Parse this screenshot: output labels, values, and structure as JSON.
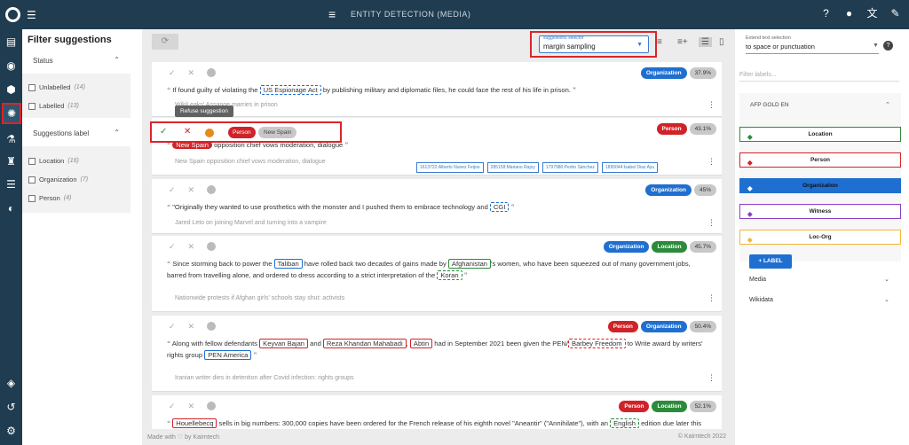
{
  "topbar": {
    "title": "ENTITY DETECTION (MEDIA)"
  },
  "filters": {
    "title": "Filter suggestions",
    "status": {
      "label": "Status",
      "items": [
        {
          "label": "Unlabelled",
          "count": "(14)"
        },
        {
          "label": "Labelled",
          "count": "(13)"
        }
      ]
    },
    "suggestions_label": {
      "label": "Suggestions label",
      "items": [
        {
          "label": "Location",
          "count": "(16)"
        },
        {
          "label": "Organization",
          "count": "(7)"
        },
        {
          "label": "Person",
          "count": "(4)"
        }
      ]
    }
  },
  "toolbar": {
    "selector_label": "suggestions selector",
    "selector_value": "margin sampling"
  },
  "tooltip": "Refuse suggestion",
  "cards": [
    {
      "badges": [
        "Organization",
        "37.9%"
      ],
      "text_pre": "If found guilty of violating the ",
      "ent1": "US Espionage Act",
      "text_post": " by publishing military and diplomatic files, he could face the rest of his life in prison.",
      "sub": "WikiLeaks' Assange marries in prison"
    },
    {
      "actions": {
        "person": "Person",
        "new_spain": "New Spain"
      },
      "badges": [
        "Person",
        "43.1%"
      ],
      "ent1": "New Spain",
      "text_post": " opposition chief vows moderation, dialogue",
      "sub": "New Spain opposition chief vows moderation, dialogue",
      "chips": [
        "1613722:Alberto Nunez Feijoo",
        "285158:Mariano Rajoy",
        "1797980:Pedro Sánchez",
        "1895044:Isabel Diaz Ayu"
      ]
    },
    {
      "badges": [
        "Organization",
        "45%"
      ],
      "text_pre": "\"Originally they wanted to use prosthetics with the monster and I pushed them to embrace technology and ",
      "ent1": "CGI",
      "sub": "Jared Leto on joining Marvel and turning into a vampire"
    },
    {
      "badges": [
        "Organization",
        "Location",
        "45.7%"
      ],
      "text_pre": "Since storming back to power the ",
      "ent1": "Taliban",
      "text_mid": " have rolled back two decades of gains made by ",
      "ent2": "Afghanistan",
      "text_mid2": "'s women, who have been squeezed out of many government jobs,",
      "line2_pre": "barred from travelling alone, and ordered to dress according to a strict interpretation of the ",
      "ent3": "Koran",
      "sub": "Nationwide protests if Afghan girls' schools stay shut: activists"
    },
    {
      "badges": [
        "Person",
        "Organization",
        "50.4%"
      ],
      "text_pre": "Along with fellow defendants ",
      "ent1": "Keyvan Bajan",
      "and": " and ",
      "ent2": "Reza Khandan Mahabadi",
      "ent3": "Abtin",
      "text_mid": " had in September 2021 been given the PEN/",
      "ent4": "Barbey Freedom",
      "text_post": " to Write award by writers'",
      "line2_pre": "rights group ",
      "ent5": "PEN America",
      "sub": "Iranian writer dies in detention after Covid infection: rights groups"
    },
    {
      "badges": [
        "Person",
        "Location",
        "52.1%"
      ],
      "ent1": "Houellebecq",
      "text_mid": " sells in big numbers: 300,000 copies have been ordered for the French release of his eighth novel \"Aneantir\" (\"Annihilate\"), with an ",
      "ent2": "English",
      "text_post": " edition due later this"
    }
  ],
  "footer": {
    "left": "Made with ♡ by Kairntech",
    "right": "©   Kairntech 2022"
  },
  "right": {
    "text_sel_label": "Extend text selection",
    "text_sel_value": "to space or punctuation",
    "filter_placeholder": "Filter labels...",
    "group_title": "AFP GOLD EN",
    "labels": [
      {
        "name": "Location",
        "color": "#2c8b3a"
      },
      {
        "name": "Person",
        "color": "#d02328"
      },
      {
        "name": "Organization",
        "color": "#1f6fd0"
      },
      {
        "name": "Witness",
        "color": "#8a3fc2"
      },
      {
        "name": "Loc-Org",
        "color": "#f2b63a"
      }
    ],
    "add_label": "+ LABEL",
    "sections": [
      "Media",
      "Wikidata"
    ]
  }
}
